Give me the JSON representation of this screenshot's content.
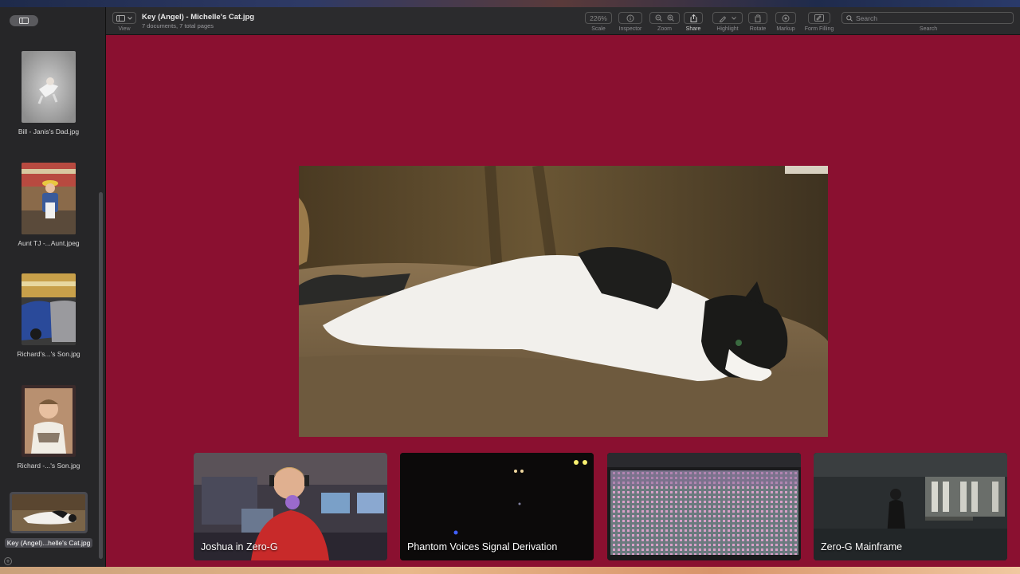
{
  "toolbar": {
    "view_label": "View",
    "doc_title": "Key (Angel) - Michelle's Cat.jpg",
    "doc_subtitle": "7 documents, 7 total pages",
    "scale_value": "226%",
    "scale_label": "Scale",
    "inspector_label": "Inspector",
    "zoom_label": "Zoom",
    "share_label": "Share",
    "highlight_label": "Highlight",
    "rotate_label": "Rotate",
    "markup_label": "Markup",
    "form_label": "Form Filling",
    "search_placeholder": "Search",
    "search_label": "Search"
  },
  "sidebar": {
    "items": [
      {
        "label": "Bill - Janis's Dad.jpg"
      },
      {
        "label": "Aunt TJ -...Aunt.jpeg"
      },
      {
        "label": "Richard's...'s Son.jpg"
      },
      {
        "label": "Richard -...'s Son.jpg"
      },
      {
        "label": "Key (Angel)...helle's Cat.jpg",
        "selected": true
      }
    ]
  },
  "tiles": [
    {
      "label": "Joshua in Zero-G"
    },
    {
      "label": "Phantom Voices Signal Derivation"
    },
    {
      "label": ""
    },
    {
      "label": "Zero-G Mainframe"
    }
  ],
  "colors": {
    "background": "#8a1030",
    "toolbar": "#2b2b2d",
    "sidebar": "#262628"
  }
}
